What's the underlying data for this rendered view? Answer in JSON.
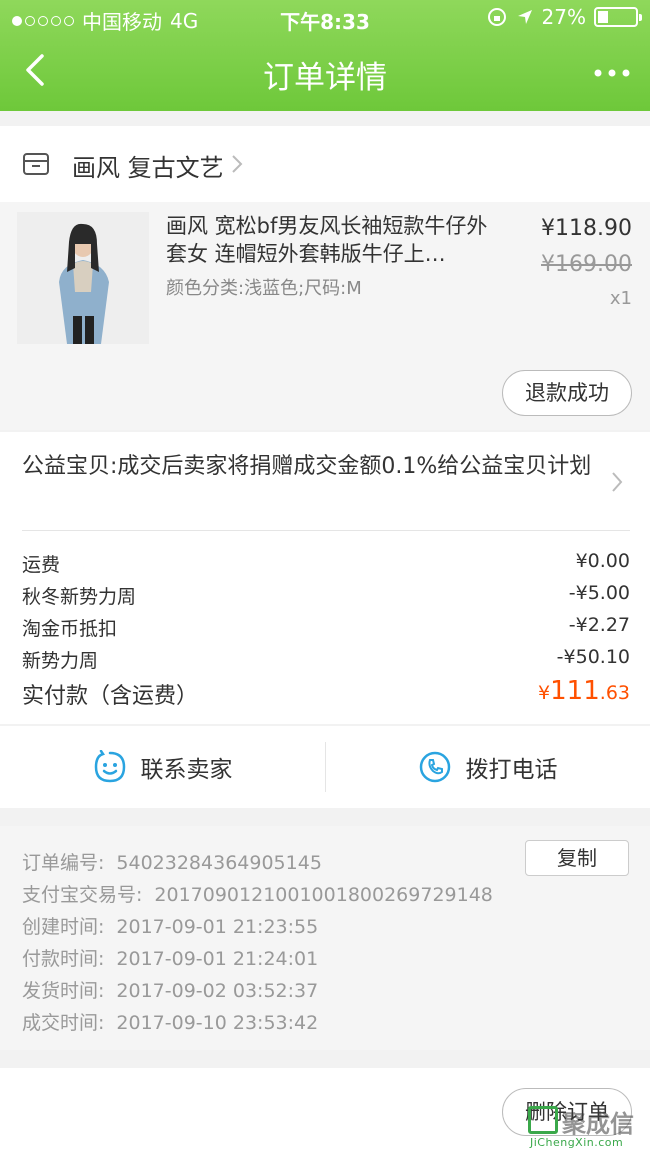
{
  "status_bar": {
    "carrier": "中国移动",
    "network": "4G",
    "time": "下午8:33",
    "battery": "27%"
  },
  "nav": {
    "title": "订单详情",
    "more": "•••"
  },
  "shop": {
    "name": "画风 复古文艺"
  },
  "product": {
    "title": "画风 宽松bf男友风长袖短款牛仔外套女 连帽短外套韩版牛仔上…",
    "sku": "颜色分类:浅蓝色;尺码:M",
    "price": "¥118.90",
    "original_price": "¥169.00",
    "quantity": "x1",
    "refund_status": "退款成功"
  },
  "charity": {
    "text": "公益宝贝:成交后卖家将捐赠成交金额0.1%给公益宝贝计划"
  },
  "fees": [
    {
      "label": "运费",
      "value": "¥0.00"
    },
    {
      "label": "秋冬新势力周",
      "value": "-¥5.00"
    },
    {
      "label": "淘金币抵扣",
      "value": "-¥2.27"
    },
    {
      "label": "新势力周",
      "value": "-¥50.10"
    }
  ],
  "total": {
    "label": "实付款（含运费）",
    "currency": "¥",
    "integer": "111",
    "decimal": ".63"
  },
  "contact": {
    "seller_label": "联系卖家",
    "phone_label": "拨打电话"
  },
  "order_info": {
    "copy_label": "复制",
    "lines": [
      {
        "key": "订单编号:",
        "value": "54023284364905145"
      },
      {
        "key": "支付宝交易号:",
        "value": "2017090121001001800269729148"
      },
      {
        "key": "创建时间:",
        "value": "2017-09-01 21:23:55"
      },
      {
        "key": "付款时间:",
        "value": "2017-09-01 21:24:01"
      },
      {
        "key": "发货时间:",
        "value": "2017-09-02 03:52:37"
      },
      {
        "key": "成交时间:",
        "value": "2017-09-10 23:53:42"
      }
    ]
  },
  "bottom": {
    "delete_label": "删除订单"
  },
  "watermark": {
    "text": "聚成信",
    "sub": "JiChengXin.com"
  },
  "colors": {
    "header_green": "#7ccf47",
    "price_orange": "#ff5000",
    "icon_blue": "#2aa4e0"
  }
}
